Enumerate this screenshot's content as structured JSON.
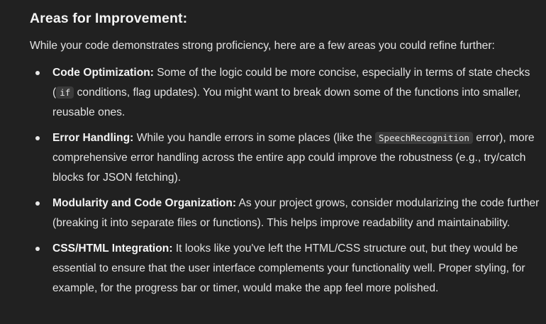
{
  "heading": "Areas for Improvement:",
  "intro": "While your code demonstrates strong proficiency, here are a few areas you could refine further:",
  "items": [
    {
      "term": "Code Optimization:",
      "text_a": " Some of the logic could be more concise, especially in terms of state checks (",
      "code": "if",
      "text_b": " conditions, flag updates). You might want to break down some of the functions into smaller, reusable ones."
    },
    {
      "term": "Error Handling:",
      "text_a": " While you handle errors in some places (like the ",
      "code": "SpeechRecognition",
      "text_b": " error), more comprehensive error handling across the entire app could improve the robustness (e.g., try/catch blocks for JSON fetching)."
    },
    {
      "term": "Modularity and Code Organization:",
      "text_a": " As your project grows, consider modularizing the code further (breaking it into separate files or functions). This helps improve readability and maintainability."
    },
    {
      "term": "CSS/HTML Integration:",
      "text_a": " It looks like you've left the HTML/CSS structure out, but they would be essential to ensure that the user interface complements your functionality well. Proper styling, for example, for the progress bar or timer, would make the app feel more polished."
    }
  ]
}
